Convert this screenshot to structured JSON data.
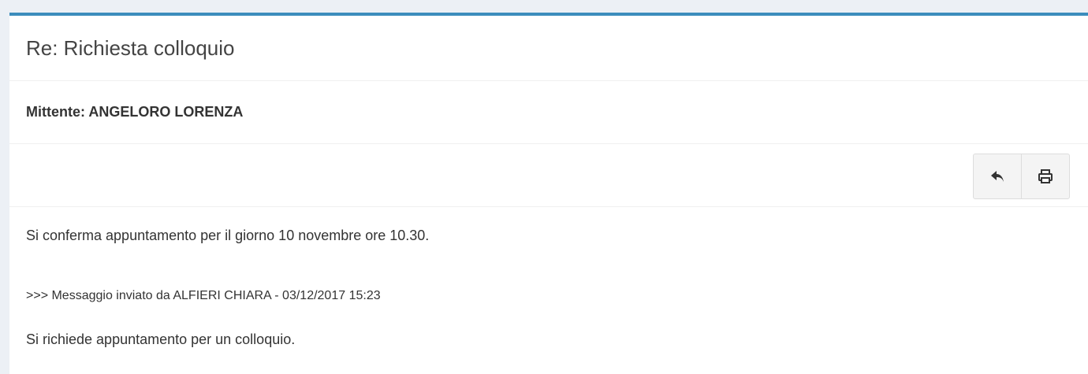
{
  "message": {
    "title": "Re: Richiesta colloquio",
    "sender": "Mittente: ANGELORO LORENZA",
    "toolbar": {
      "reply_icon": "reply-icon",
      "print_icon": "print-icon"
    },
    "body": {
      "line1": "Si conferma appuntamento per il giorno 10 novembre ore 10.30.",
      "quote_header": ">>> Messaggio inviato da ALFIERI CHIARA - 03/12/2017 15:23",
      "quote_text": "Si richiede appuntamento per un colloquio."
    }
  },
  "colors": {
    "accent": "#3c8dbc",
    "background": "#ecf0f5"
  }
}
